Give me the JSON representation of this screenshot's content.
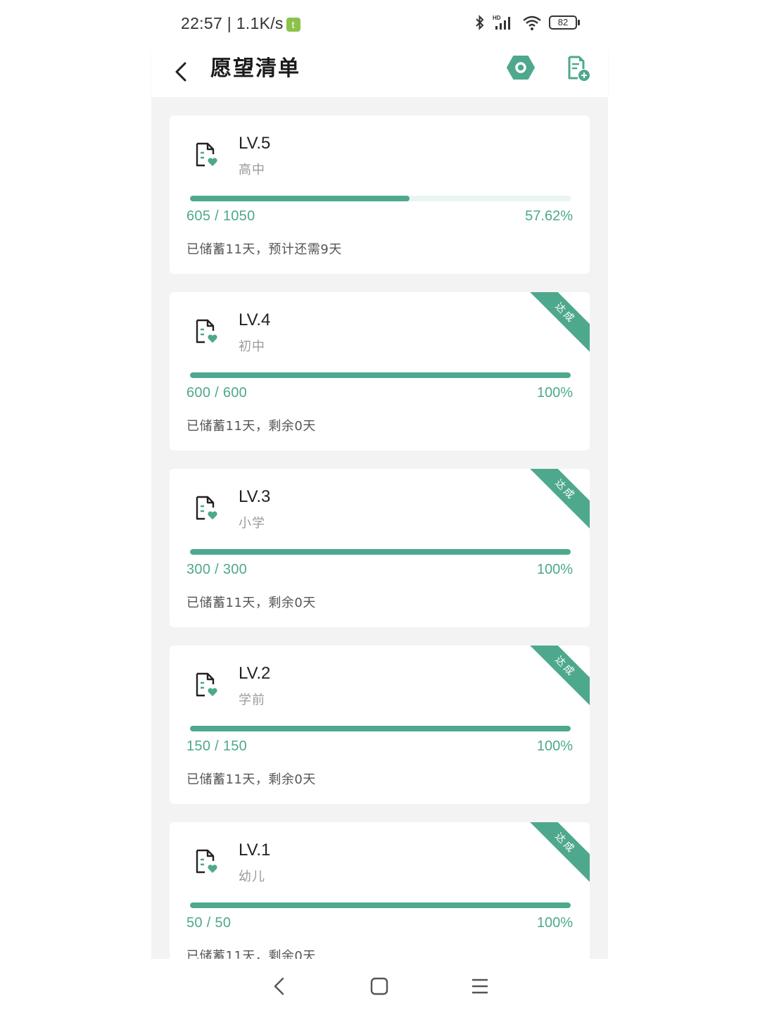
{
  "status_bar": {
    "time_speed": "22:57 | 1.1K/s",
    "badge": "t",
    "battery": "82"
  },
  "header": {
    "title": "愿望清单"
  },
  "cards": [
    {
      "level": "LV.5",
      "stage": "高中",
      "amount": "605 / 1050",
      "percent": "57.62%",
      "note": "已储蓄11天，预计还需9天",
      "progress": 0.5762,
      "ribbon": ""
    },
    {
      "level": "LV.4",
      "stage": "初中",
      "amount": "600 / 600",
      "percent": "100%",
      "note": "已储蓄11天，剩余0天",
      "progress": 1.0,
      "ribbon": "达成"
    },
    {
      "level": "LV.3",
      "stage": "小学",
      "amount": "300 / 300",
      "percent": "100%",
      "note": "已储蓄11天，剩余0天",
      "progress": 1.0,
      "ribbon": "达成"
    },
    {
      "level": "LV.2",
      "stage": "学前",
      "amount": "150 / 150",
      "percent": "100%",
      "note": "已储蓄11天，剩余0天",
      "progress": 1.0,
      "ribbon": "达成"
    },
    {
      "level": "LV.1",
      "stage": "幼儿",
      "amount": "50 / 50",
      "percent": "100%",
      "note": "已储蓄11天，剩余0天",
      "progress": 1.0,
      "ribbon": "达成"
    }
  ],
  "colors": {
    "accent": "#4ea88e",
    "track": "#eaf4f2",
    "background": "#f3f3f3"
  },
  "icons": {
    "header": [
      "back-arrow-icon",
      "settings-hex-icon",
      "add-document-icon"
    ],
    "card": "wish-document-icon",
    "navigation": [
      "nav-back-icon",
      "nav-home-icon",
      "nav-menu-icon"
    ]
  }
}
